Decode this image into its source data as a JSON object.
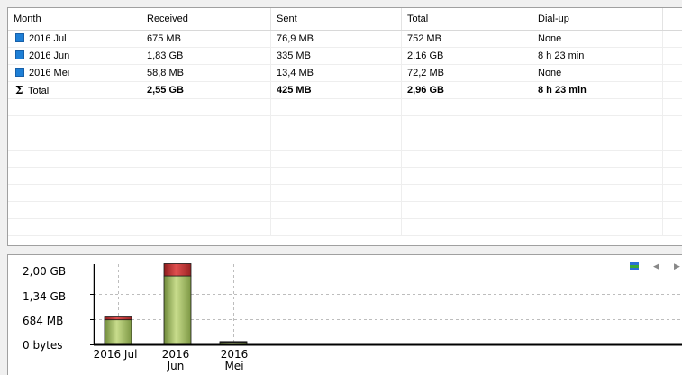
{
  "table": {
    "columns": [
      "Month",
      "Received",
      "Sent",
      "Total",
      "Dial-up"
    ],
    "rows": [
      {
        "month": "2016 Jul",
        "received": "675 MB",
        "sent": "76,9 MB",
        "total": "752 MB",
        "dialup": "None"
      },
      {
        "month": "2016 Jun",
        "received": "1,83 GB",
        "sent": "335 MB",
        "total": "2,16 GB",
        "dialup": "8 h 23 min"
      },
      {
        "month": "2016 Mei",
        "received": "58,8 MB",
        "sent": "13,4 MB",
        "total": "72,2 MB",
        "dialup": "None"
      }
    ],
    "total_row": {
      "label": "Total",
      "received": "2,55 GB",
      "sent": "425 MB",
      "total": "2,96 GB",
      "dialup": "8 h 23 min"
    },
    "row_icon_color": "#1e7fd6"
  },
  "chart_data": {
    "type": "bar",
    "stacked": true,
    "categories": [
      "2016 Jul",
      "2016 Jun",
      "2016 Mei"
    ],
    "series": [
      {
        "values_mb": [
          675,
          1874,
          58.8
        ],
        "color": "#a8c06a"
      },
      {
        "values_mb": [
          76.9,
          335,
          13.4
        ],
        "color": "#c83232"
      }
    ],
    "yticks": [
      "2,00 GB",
      "1,34 GB",
      "684 MB",
      "0 bytes"
    ],
    "ytick_values_mb": [
      2048,
      1372,
      684,
      0
    ],
    "ylim_mb": [
      0,
      2048
    ],
    "grid": true,
    "legend": "top-right"
  }
}
